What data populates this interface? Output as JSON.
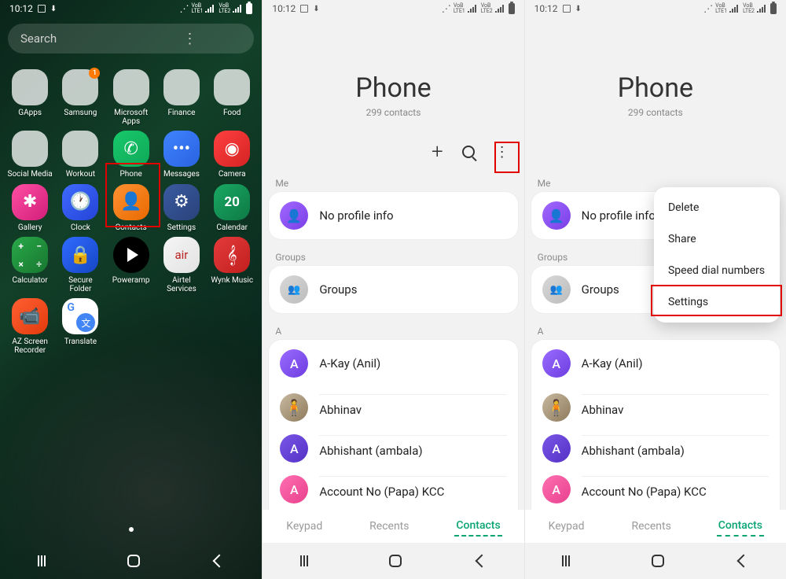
{
  "status": {
    "time": "10:12"
  },
  "search": {
    "placeholder": "Search"
  },
  "home": {
    "apps": [
      {
        "label": "GApps",
        "type": "folder",
        "colors": [
          "c-red",
          "c-blue",
          "c-yellow",
          "c-green",
          "c-red",
          "c-blue",
          "c-yellow",
          "c-green",
          "c-red"
        ]
      },
      {
        "label": "Samsung",
        "type": "folder",
        "badge": "1",
        "colors": [
          "c-orange",
          "c-white",
          "c-teal",
          "c-red",
          "c-pink",
          "c-yellow",
          "c-blue",
          "c-white",
          "c-grey"
        ]
      },
      {
        "label": "Microsoft Apps",
        "type": "folder",
        "colors": [
          "c-blue",
          "c-orange",
          "c-blue",
          "c-green",
          "c-purple",
          "c-white",
          "",
          "",
          ""
        ]
      },
      {
        "label": "Finance",
        "type": "folder",
        "colors": [
          "c-blue",
          "c-red",
          "c-blue",
          "c-orange",
          "",
          "",
          "",
          "",
          ""
        ]
      },
      {
        "label": "Food",
        "type": "folder",
        "colors": [
          "c-red",
          "c-orange",
          "",
          "",
          "",
          "",
          "",
          "",
          ""
        ]
      },
      {
        "label": "Social Media",
        "type": "folder",
        "colors": [
          "c-teal",
          "c-pink",
          "c-green",
          "c-blue",
          "",
          "",
          "",
          "",
          ""
        ]
      },
      {
        "label": "Workout",
        "type": "folder",
        "colors": [
          "c-red",
          "c-grey",
          "c-white",
          "",
          "",
          "",
          "",
          "",
          ""
        ]
      },
      {
        "label": "Phone",
        "type": "phone",
        "glyph": "✆"
      },
      {
        "label": "Messages",
        "type": "messages",
        "glyph": "•••"
      },
      {
        "label": "Camera",
        "type": "camera",
        "glyph": "◉"
      },
      {
        "label": "Gallery",
        "type": "gallery",
        "glyph": "✱"
      },
      {
        "label": "Clock",
        "type": "clock",
        "glyph": "🕐"
      },
      {
        "label": "Contacts",
        "type": "contacts",
        "glyph": "👤"
      },
      {
        "label": "Settings",
        "type": "settings",
        "glyph": "⚙"
      },
      {
        "label": "Calendar",
        "type": "calendar",
        "glyph": "20"
      },
      {
        "label": "Calculator",
        "type": "calculator"
      },
      {
        "label": "Secure Folder",
        "type": "secure",
        "glyph": "🔒"
      },
      {
        "label": "Poweramp",
        "type": "poweramp"
      },
      {
        "label": "Airtel Services",
        "type": "airtel",
        "glyph": "air"
      },
      {
        "label": "Wynk Music",
        "type": "wynk",
        "glyph": "𝄞"
      },
      {
        "label": "AZ Screen Recorder",
        "type": "azrec",
        "glyph": "📹"
      },
      {
        "label": "Translate",
        "type": "translate"
      }
    ]
  },
  "phone": {
    "title": "Phone",
    "subtitle": "299 contacts",
    "sections": {
      "me_label": "Me",
      "me_text": "No profile info",
      "groups_label": "Groups",
      "groups_text": "Groups",
      "index_a": "A"
    },
    "contacts": [
      {
        "avatar": "A",
        "cls": "purple",
        "name": "A-Kay (Anil)"
      },
      {
        "avatar": "🧍",
        "cls": "photo",
        "name": "Abhinav"
      },
      {
        "avatar": "A",
        "cls": "deep",
        "name": "Abhishant (ambala)"
      },
      {
        "avatar": "A",
        "cls": "pink",
        "name": "Account No (Papa) KCC"
      }
    ],
    "tabs": {
      "keypad": "Keypad",
      "recents": "Recents",
      "contacts": "Contacts"
    },
    "menu": {
      "delete": "Delete",
      "share": "Share",
      "speed": "Speed dial numbers",
      "settings": "Settings"
    }
  }
}
